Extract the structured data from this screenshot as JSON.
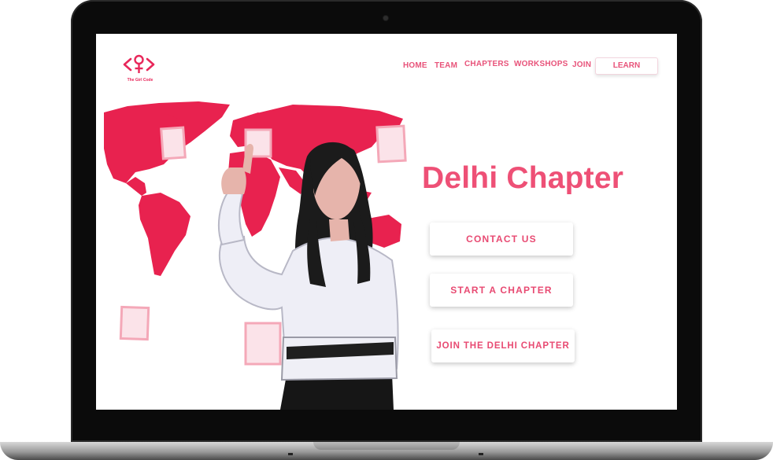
{
  "header": {
    "logo_caption": "The Girl Code",
    "nav": [
      {
        "label": "HOME"
      },
      {
        "label": "TEAM"
      },
      {
        "label": "CHAPTERS"
      },
      {
        "label": "WORKSHOPS"
      },
      {
        "label": "JOIN"
      }
    ],
    "learn_label": "LEARN"
  },
  "hero": {
    "title": "Delhi Chapter",
    "buttons": [
      {
        "label": "CONTACT US"
      },
      {
        "label": "START A CHAPTER"
      },
      {
        "label": "JOIN THE DELHI CHAPTER"
      }
    ]
  },
  "colors": {
    "brand": "#e8275a",
    "accent_text": "#ee5076",
    "laptop_bezel": "#0b0b0b"
  }
}
